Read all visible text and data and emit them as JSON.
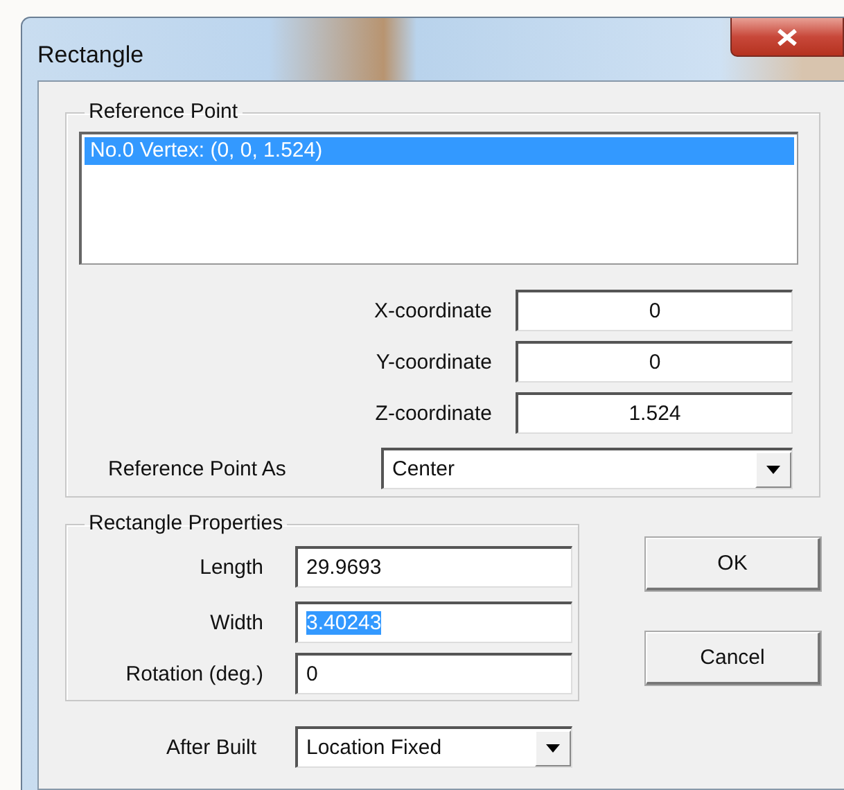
{
  "window": {
    "title": "Rectangle"
  },
  "reference_point": {
    "title": "Reference Point",
    "items": [
      {
        "label": "No.0 Vertex: (0, 0, 1.524)",
        "selected": true
      }
    ],
    "coordinates": [
      {
        "label": "X-coordinate",
        "value": "0"
      },
      {
        "label": "Y-coordinate",
        "value": "0"
      },
      {
        "label": "Z-coordinate",
        "value": "1.524"
      }
    ],
    "reference_point_as": {
      "label": "Reference Point As",
      "value": "Center"
    }
  },
  "rectangle_properties": {
    "title": "Rectangle Properties",
    "fields": [
      {
        "label": "Length",
        "value": "29.9693",
        "text_selected": false
      },
      {
        "label": "Width",
        "value": "3.40243",
        "text_selected": true
      },
      {
        "label": "Rotation (deg.)",
        "value": "0",
        "text_selected": false
      }
    ]
  },
  "after_built": {
    "label": "After Built",
    "value": "Location Fixed"
  },
  "buttons": [
    {
      "label": "OK"
    },
    {
      "label": "Cancel"
    }
  ]
}
